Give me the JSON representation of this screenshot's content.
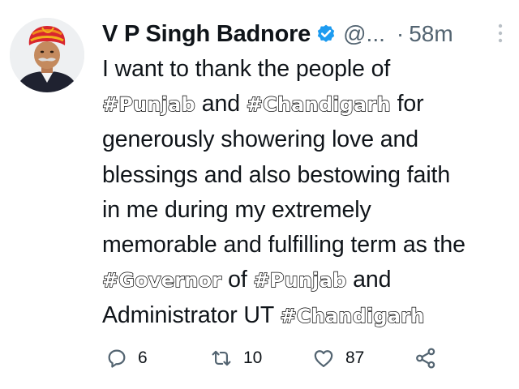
{
  "author": {
    "name": "V P Singh Badnore",
    "handle": "@...",
    "separator": "·",
    "time": "58m",
    "verified_color": "#1d9bf0"
  },
  "tweet": {
    "lines": [
      [
        {
          "t": "I want to thank the people of"
        }
      ],
      [
        {
          "t": "#Punjab",
          "tag": true
        },
        {
          "t": " and "
        },
        {
          "t": "#Chandigarh",
          "tag": true
        },
        {
          "t": " for"
        }
      ],
      [
        {
          "t": "generously showering love and"
        }
      ],
      [
        {
          "t": "blessings and also bestowing faith"
        }
      ],
      [
        {
          "t": "in me during my extremely"
        }
      ],
      [
        {
          "t": "memorable and fulfilling term as the"
        }
      ],
      [
        {
          "t": "#Governor",
          "tag": true
        },
        {
          "t": " of "
        },
        {
          "t": "#Punjab",
          "tag": true
        },
        {
          "t": " and"
        }
      ],
      [
        {
          "t": "Administrator UT "
        },
        {
          "t": "#Chandigarh",
          "tag": true
        }
      ]
    ]
  },
  "actions": {
    "reply_count": "6",
    "retweet_count": "10",
    "like_count": "87"
  },
  "icons": {
    "reply": "reply-icon",
    "retweet": "retweet-icon",
    "like": "heart-icon",
    "share": "share-icon",
    "more": "more-options-icon",
    "verified": "verified-badge-icon"
  }
}
